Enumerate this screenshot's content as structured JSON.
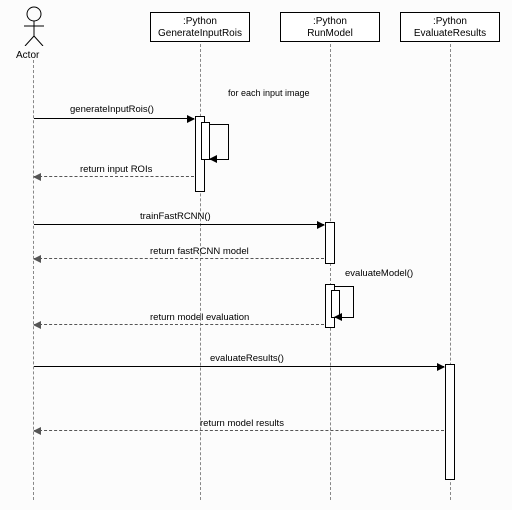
{
  "actor": {
    "label": "Actor"
  },
  "participants": [
    {
      "class": ":Python",
      "name": "GenerateInputRois"
    },
    {
      "class": ":Python",
      "name": "RunModel"
    },
    {
      "class": ":Python",
      "name": "EvaluateResults"
    }
  ],
  "loop_label": "for each input image",
  "messages": {
    "m1": "generateInputRois()",
    "r1": "return input ROIs",
    "m2": "trainFastRCNN()",
    "r2": "return fastRCNN model",
    "m3": "evaluateModel()",
    "r3": "return model evaluation",
    "m4": "evaluateResults()",
    "r4": "return model results"
  },
  "chart_data": {
    "type": "sequence-diagram",
    "actors": [
      "Actor"
    ],
    "participants": [
      ":Python GenerateInputRois",
      ":Python RunModel",
      ":Python EvaluateResults"
    ],
    "interactions": [
      {
        "from": "Actor",
        "to": ":Python GenerateInputRois",
        "label": "generateInputRois()",
        "kind": "call"
      },
      {
        "from": ":Python GenerateInputRois",
        "to": ":Python GenerateInputRois",
        "label": "for each input image",
        "kind": "loop"
      },
      {
        "from": ":Python GenerateInputRois",
        "to": "Actor",
        "label": "return input ROIs",
        "kind": "return"
      },
      {
        "from": "Actor",
        "to": ":Python RunModel",
        "label": "trainFastRCNN()",
        "kind": "call"
      },
      {
        "from": ":Python RunModel",
        "to": "Actor",
        "label": "return fastRCNN model",
        "kind": "return"
      },
      {
        "from": ":Python RunModel",
        "to": ":Python RunModel",
        "label": "evaluateModel()",
        "kind": "self-call"
      },
      {
        "from": ":Python RunModel",
        "to": "Actor",
        "label": "return model evaluation",
        "kind": "return"
      },
      {
        "from": "Actor",
        "to": ":Python EvaluateResults",
        "label": "evaluateResults()",
        "kind": "call"
      },
      {
        "from": ":Python EvaluateResults",
        "to": "Actor",
        "label": "return model results",
        "kind": "return"
      }
    ]
  }
}
